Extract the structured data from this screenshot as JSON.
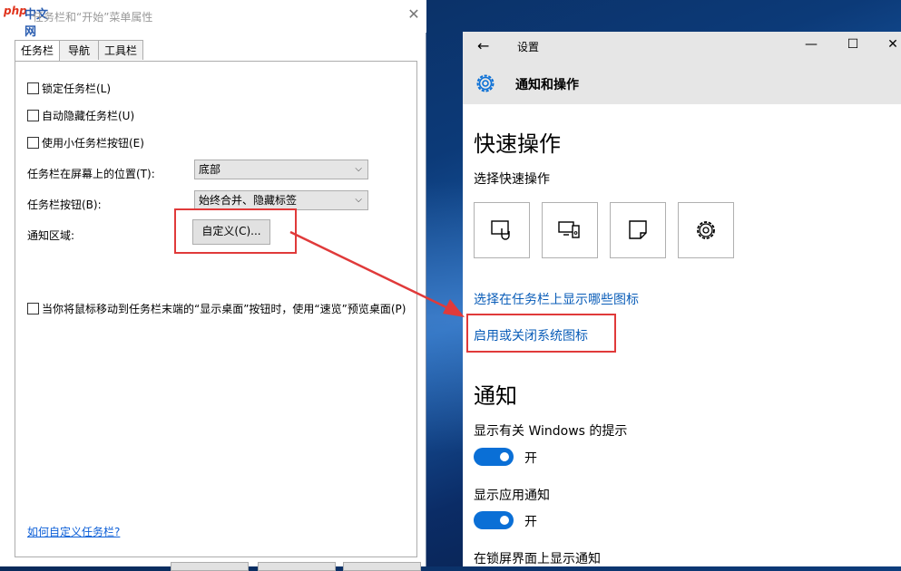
{
  "dialog": {
    "title": "任务栏和“开始”菜单属性",
    "logo": {
      "php": "php",
      "zh": "中文网"
    },
    "tabs": [
      "任务栏",
      "导航",
      "工具栏"
    ],
    "checkboxes": [
      "锁定任务栏(L)",
      "自动隐藏任务栏(U)",
      "使用小任务栏按钮(E)"
    ],
    "position_label": "任务栏在屏幕上的位置(T):",
    "position_value": "底部",
    "buttons_label": "任务栏按钮(B):",
    "buttons_value": "始终合并、隐藏标签",
    "notify_label": "通知区域:",
    "customize_button": "自定义(C)...",
    "peek_checkbox": "当你将鼠标移动到任务栏末端的“显示桌面”按钮时，使用“速览”预览桌面(P)",
    "help_link": "如何自定义任务栏?",
    "close_icon": "close-icon"
  },
  "settings": {
    "window_title": "设置",
    "header_title": "通知和操作",
    "quick_actions_heading": "快速操作",
    "choose_quick_actions": "选择快速操作",
    "quick_action_icons": [
      "tablet-mode-icon",
      "connect-icon",
      "note-icon",
      "settings-gear-icon"
    ],
    "link_taskbar_icons": "选择在任务栏上显示哪些图标",
    "link_system_icons": "启用或关闭系统图标",
    "notifications_heading": "通知",
    "windows_tips": "显示有关 Windows 的提示",
    "toggle_on": "开",
    "app_notifications": "显示应用通知",
    "lockscreen_notifications": "在锁屏界面上显示通知",
    "accent_color": "#0a6fd6",
    "link_color": "#0a5db8",
    "highlight_color": "#e03a3a"
  }
}
